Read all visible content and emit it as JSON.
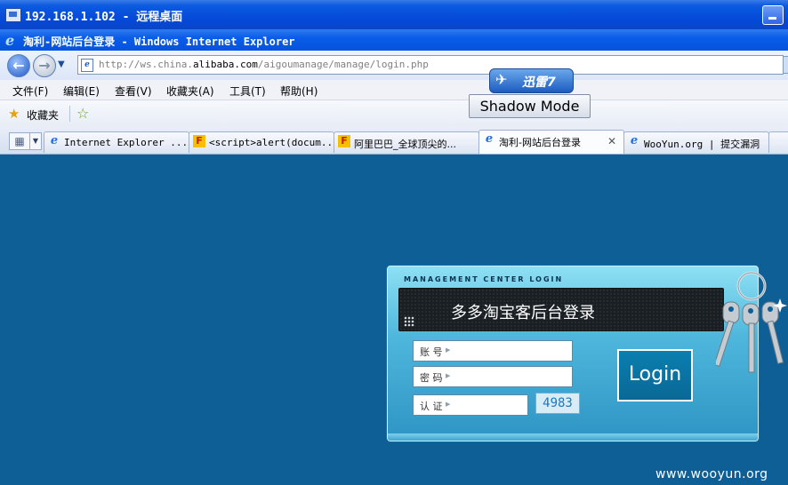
{
  "remote_window": {
    "title": "192.168.1.102 - 远程桌面"
  },
  "browser": {
    "title": "淘利-网站后台登录 - Windows Internet Explorer",
    "address_prefix": "http://ws.china.",
    "address_domain": "alibaba.com",
    "address_path": "/aigoumanage/manage/login.php"
  },
  "menu": {
    "items": [
      "文件(F)",
      "编辑(E)",
      "查看(V)",
      "收藏夹(A)",
      "工具(T)",
      "帮助(H)"
    ]
  },
  "favorites": {
    "label": "收藏夹"
  },
  "tabs": [
    {
      "label": "Internet Explorer ...",
      "icon": "ie-icon"
    },
    {
      "label": "<script>alert(docum...",
      "icon": "firefox-page-icon"
    },
    {
      "label": "阿里巴巴_全球顶尖的...",
      "icon": "firefox-page-icon"
    },
    {
      "label": "淘利-网站后台登录",
      "icon": "ie-icon",
      "active": true
    },
    {
      "label": "WooYun.org | 提交漏洞",
      "icon": "ie-icon"
    }
  ],
  "xunlei": {
    "label": "迅雷7"
  },
  "shadow_mode": {
    "label": "Shadow Mode"
  },
  "login": {
    "header": "MANAGEMENT CENTER LOGIN",
    "title": "多多淘宝客后台登录",
    "account_label": "账 号",
    "password_label": "密 码",
    "code_label": "认 证",
    "captcha": "4983",
    "button": "Login"
  },
  "watermark": "www.wooyun.org",
  "colors": {
    "desktop": "#0d5f96",
    "panel": "#4fb7dc",
    "titlebar": "#0548d8"
  }
}
